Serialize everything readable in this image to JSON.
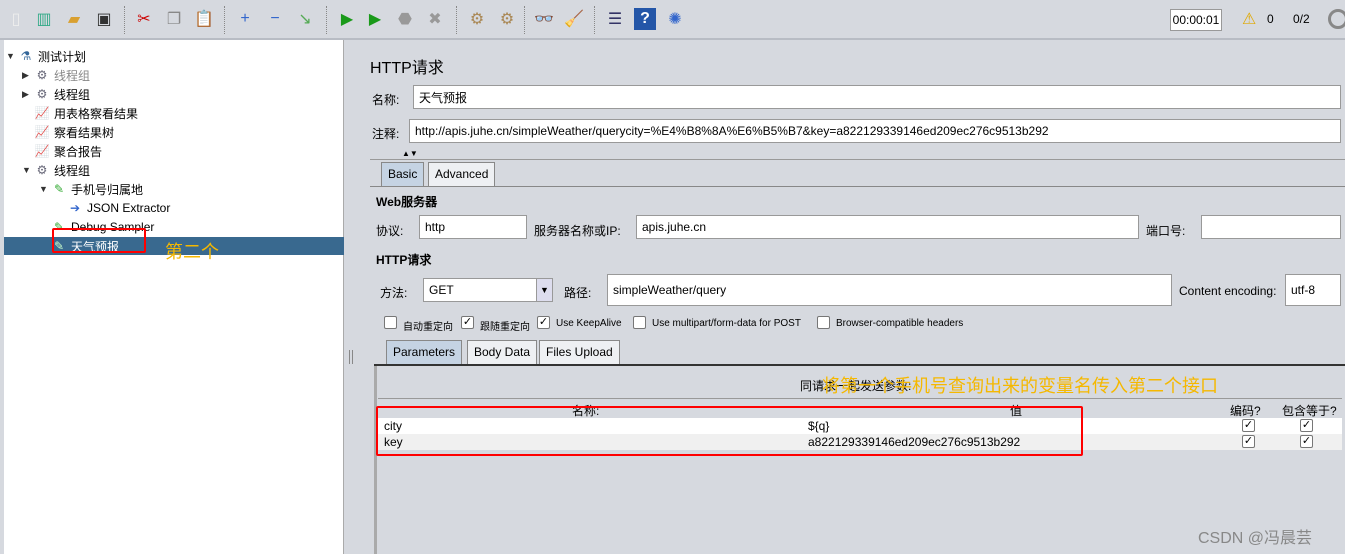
{
  "toolbar": {
    "icons": [
      "new-icon",
      "templates-icon",
      "open-icon",
      "save-icon",
      "cut-icon",
      "copy-icon",
      "paste-icon",
      "expand-icon",
      "collapse-icon",
      "toggle-icon",
      "start-icon",
      "start-no-pause-icon",
      "stop-icon",
      "shutdown-icon",
      "clear-icon",
      "clear-all-icon",
      "search-icon",
      "reset-search-icon",
      "function-helper-icon",
      "help-icon",
      "remote-icon"
    ],
    "timer": "00:00:01",
    "warnings": "0",
    "threads": "0/2"
  },
  "tree": {
    "items": [
      {
        "label": "测试计划",
        "icon": "test-plan-icon"
      },
      {
        "label": "线程组",
        "icon": "thread-group-icon",
        "disabled": true
      },
      {
        "label": "线程组",
        "icon": "thread-group-icon"
      },
      {
        "label": "用表格察看结果",
        "icon": "listener-icon"
      },
      {
        "label": "察看结果树",
        "icon": "listener-icon"
      },
      {
        "label": "聚合报告",
        "icon": "listener-icon"
      },
      {
        "label": "线程组",
        "icon": "thread-group-icon"
      },
      {
        "label": "手机号归属地",
        "icon": "sampler-icon"
      },
      {
        "label": "JSON Extractor",
        "icon": "extractor-icon"
      },
      {
        "label": "Debug Sampler",
        "icon": "sampler-icon"
      },
      {
        "label": "天气预报",
        "icon": "sampler-icon",
        "selected": true
      }
    ]
  },
  "annotation1": "第二个",
  "annotation2": "将第一个手机号查询出来的变量名传入第二个接口",
  "panel": {
    "title": "HTTP请求",
    "name_label": "名称:",
    "name_value": "天气预报",
    "comment_label": "注释:",
    "comment_value": "http://apis.juhe.cn/simpleWeather/querycity=%E4%B8%8A%E6%B5%B7&key=a822129339146ed209ec276c9513b292",
    "tabs": [
      "Basic",
      "Advanced"
    ],
    "web_server": "Web服务器",
    "protocol_label": "协议:",
    "protocol_value": "http",
    "server_label": "服务器名称或IP:",
    "server_value": "apis.juhe.cn",
    "port_label": "端口号:",
    "port_value": "",
    "http_request": "HTTP请求",
    "method_label": "方法:",
    "method_value": "GET",
    "path_label": "路径:",
    "path_value": "simpleWeather/query",
    "encoding_label": "Content encoding:",
    "encoding_value": "utf-8",
    "checkboxes": [
      {
        "label": "自动重定向",
        "checked": false
      },
      {
        "label": "跟随重定向",
        "checked": true
      },
      {
        "label": "Use KeepAlive",
        "checked": true
      },
      {
        "label": "Use multipart/form-data for POST",
        "checked": false
      },
      {
        "label": "Browser-compatible headers",
        "checked": false
      }
    ],
    "param_tabs": [
      "Parameters",
      "Body Data",
      "Files Upload"
    ],
    "send_params_label": "同请求一起发送参数:",
    "columns": [
      "名称:",
      "值",
      "编码?",
      "包含等于?"
    ],
    "rows": [
      {
        "name": "city",
        "value": "${q}",
        "encode": true,
        "include_equals": true
      },
      {
        "name": "key",
        "value": "a822129339146ed209ec276c9513b292",
        "encode": true,
        "include_equals": true
      }
    ]
  },
  "watermark": "CSDN @冯晨芸"
}
